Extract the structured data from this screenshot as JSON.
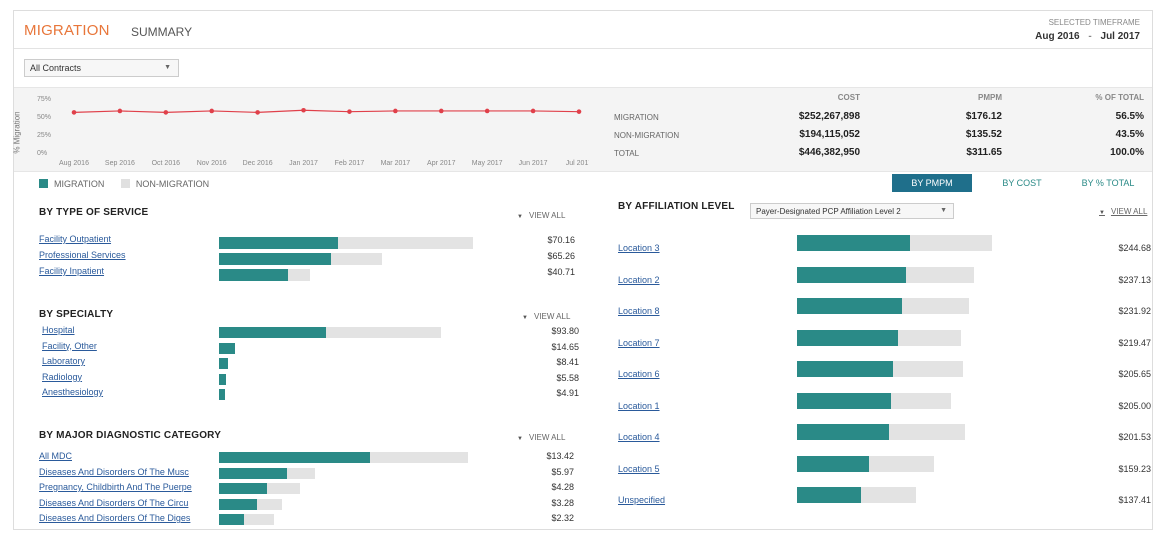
{
  "header": {
    "tab_migration": "MIGRATION",
    "tab_summary": "SUMMARY",
    "timeframe_label": "SELECTED TIMEFRAME",
    "timeframe_start": "Aug 2016",
    "timeframe_sep": "-",
    "timeframe_end": "Jul 2017"
  },
  "contract_select": {
    "value": "All Contracts"
  },
  "trend_chart": {
    "y_axis_label": "% Migration",
    "y_ticks": [
      "75%",
      "50%",
      "25%",
      "0%"
    ],
    "x_ticks": [
      "Aug 2016",
      "Sep 2016",
      "Oct 2016",
      "Nov 2016",
      "Dec 2016",
      "Jan 2017",
      "Feb 2017",
      "Mar 2017",
      "Apr 2017",
      "May 2017",
      "Jun 2017",
      "Jul 2017"
    ],
    "values_pct": [
      55,
      57,
      55,
      57,
      55,
      58,
      56,
      57,
      57,
      57,
      57,
      56
    ],
    "line_color": "#e0404a"
  },
  "summary": {
    "headers": {
      "cost": "COST",
      "pmpm": "PMPM",
      "pct": "% OF TOTAL"
    },
    "rows": [
      {
        "label": "MIGRATION",
        "cost": "$252,267,898",
        "pmpm": "$176.12",
        "pct": "56.5%"
      },
      {
        "label": "NON-MIGRATION",
        "cost": "$194,115,052",
        "pmpm": "$135.52",
        "pct": "43.5%"
      },
      {
        "label": "TOTAL",
        "cost": "$446,382,950",
        "pmpm": "$311.65",
        "pct": "100.0%"
      }
    ]
  },
  "legend": {
    "migration": "MIGRATION",
    "non_migration": "NON-MIGRATION",
    "migration_color": "#2a8a87",
    "non_migration_color": "#e0e0e0"
  },
  "toggles": {
    "by_pmpm": "BY PMPM",
    "by_cost": "BY COST",
    "by_pct": "BY % TOTAL",
    "active": "by_pmpm"
  },
  "view_all": "VIEW ALL",
  "type_of_service": {
    "title": "BY TYPE OF SERVICE",
    "rows": [
      {
        "label": "Facility Outpatient",
        "value": "$70.16",
        "mig": 0.47,
        "total": 1.0
      },
      {
        "label": "Professional Services",
        "value": "$65.26",
        "mig": 0.44,
        "total": 0.64
      },
      {
        "label": "Facility Inpatient",
        "value": "$40.71",
        "mig": 0.27,
        "total": 0.36
      }
    ]
  },
  "specialty": {
    "title": "BY SPECIALTY",
    "rows": [
      {
        "label": "Hospital",
        "value": "$93.80",
        "mig": 0.48,
        "total": 1.0
      },
      {
        "label": "Facility, Other",
        "value": "$14.65",
        "mig": 0.07,
        "total": 0.07
      },
      {
        "label": "Laboratory",
        "value": "$8.41",
        "mig": 0.04,
        "total": 0.04
      },
      {
        "label": "Radiology",
        "value": "$5.58",
        "mig": 0.03,
        "total": 0.03
      },
      {
        "label": "Anesthesiology",
        "value": "$4.91",
        "mig": 0.025,
        "total": 0.025
      }
    ]
  },
  "mdc": {
    "title": "BY MAJOR DIAGNOSTIC CATEGORY",
    "rows": [
      {
        "label": "All MDC",
        "value": "$13.42",
        "mig": 0.6,
        "total": 0.99
      },
      {
        "label": "Diseases And Disorders Of The Musc",
        "value": "$5.97",
        "mig": 0.27,
        "total": 0.38
      },
      {
        "label": "Pregnancy, Childbirth And The Puerpe",
        "value": "$4.28",
        "mig": 0.19,
        "total": 0.32
      },
      {
        "label": "Diseases And Disorders Of The Circu",
        "value": "$3.28",
        "mig": 0.15,
        "total": 0.25
      },
      {
        "label": "Diseases And Disorders Of The Diges",
        "value": "$2.32",
        "mig": 0.1,
        "total": 0.22
      }
    ]
  },
  "affiliation": {
    "title": "BY AFFILIATION LEVEL",
    "select_value": "Payer-Designated PCP Affiliation Level 2",
    "view_all": "VIEW ALL",
    "rows": [
      {
        "label": "Location 3",
        "value": "$244.68",
        "mig": 0.58,
        "total": 1.0
      },
      {
        "label": "Location 2",
        "value": "$237.13",
        "mig": 0.56,
        "total": 0.91
      },
      {
        "label": "Location 8",
        "value": "$231.92",
        "mig": 0.54,
        "total": 0.88
      },
      {
        "label": "Location 7",
        "value": "$219.47",
        "mig": 0.52,
        "total": 0.84
      },
      {
        "label": "Location 6",
        "value": "$205.65",
        "mig": 0.49,
        "total": 0.85
      },
      {
        "label": "Location 1",
        "value": "$205.00",
        "mig": 0.48,
        "total": 0.79
      },
      {
        "label": "Location 4",
        "value": "$201.53",
        "mig": 0.47,
        "total": 0.86
      },
      {
        "label": "Location 5",
        "value": "$159.23",
        "mig": 0.37,
        "total": 0.7
      },
      {
        "label": "Unspecified",
        "value": "$137.41",
        "mig": 0.33,
        "total": 0.61
      }
    ]
  }
}
